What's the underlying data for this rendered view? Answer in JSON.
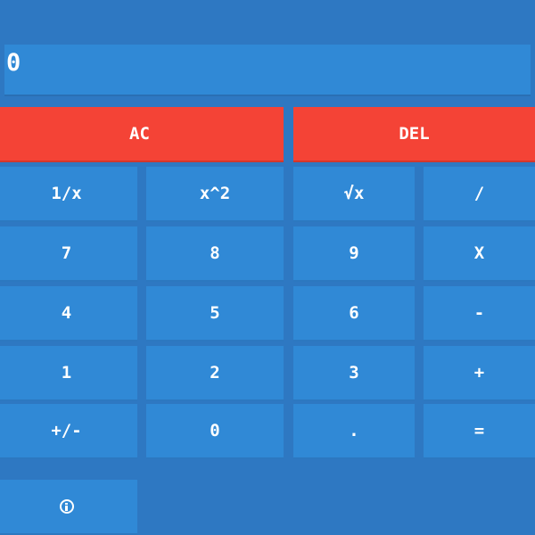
{
  "display": {
    "value": "0"
  },
  "controls": {
    "clear_label": "AC",
    "delete_label": "DEL"
  },
  "keys": {
    "reciprocal": "1/x",
    "square": "x^2",
    "sqrt": "√x",
    "divide": "/",
    "d7": "7",
    "d8": "8",
    "d9": "9",
    "multiply": "X",
    "d4": "4",
    "d5": "5",
    "d6": "6",
    "subtract": "-",
    "d1": "1",
    "d2": "2",
    "d3": "3",
    "add": "+",
    "negate": "+/-",
    "d0": "0",
    "decimal": ".",
    "equals": "="
  },
  "icons": {
    "info": "info-icon"
  },
  "colors": {
    "background": "#2e78c2",
    "key": "#3089d6",
    "danger": "#f44336"
  }
}
